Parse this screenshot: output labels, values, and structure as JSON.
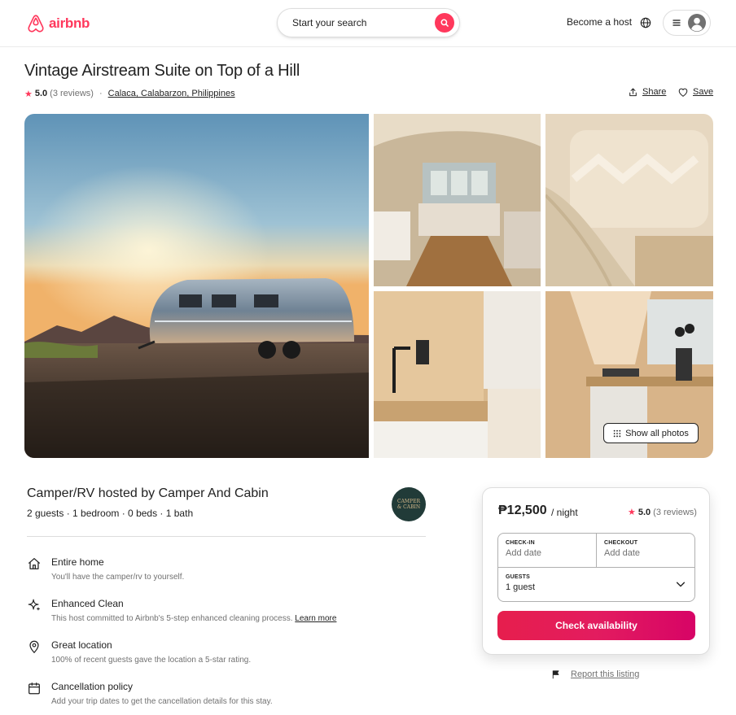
{
  "header": {
    "logo_text": "airbnb",
    "search_label": "Start your search",
    "become_host": "Become a host",
    "icons": [
      "airbnb-logo-icon",
      "search-icon",
      "globe-icon",
      "menu-icon",
      "user-icon"
    ]
  },
  "listing": {
    "title": "Vintage Airstream Suite on Top of a Hill",
    "rating": "5.0",
    "reviews": "(3 reviews)",
    "separator": "·",
    "location": "Calaca, Calabarzon, Philippines",
    "share_label": "Share",
    "save_label": "Save"
  },
  "gallery": {
    "show_all_label": "Show all photos"
  },
  "host": {
    "title": "Camper/RV hosted by Camper And Cabin",
    "details": "2 guests · 1 bedroom · 0 beds · 1 bath",
    "avatar_text": [
      "CAMPER",
      "& CABIN"
    ]
  },
  "features": [
    {
      "icon": "home-icon",
      "title": "Entire home",
      "desc": "You'll have the camper/rv to yourself."
    },
    {
      "icon": "sparkle-icon",
      "title": "Enhanced Clean",
      "desc": "This host committed to Airbnb's 5-step enhanced cleaning process.",
      "link": "Learn more"
    },
    {
      "icon": "location-pin-icon",
      "title": "Great location",
      "desc": "100% of recent guests gave the location a 5-star rating."
    },
    {
      "icon": "calendar-icon",
      "title": "Cancellation policy",
      "desc": "Add your trip dates to get the cancellation details for this stay."
    }
  ],
  "booking": {
    "price": "₱12,500",
    "per_night": "/ night",
    "rating": "5.0",
    "reviews": "(3 reviews)",
    "checkin_label": "CHECK-IN",
    "checkin_value": "Add date",
    "checkout_label": "CHECKOUT",
    "checkout_value": "Add date",
    "guests_label": "GUESTS",
    "guests_value": "1 guest",
    "cta": "Check availability"
  },
  "report": {
    "label": "Report this listing"
  },
  "colors": {
    "brand": "#ff385c",
    "text": "#222222",
    "muted": "#717171",
    "border": "#dddddd"
  }
}
